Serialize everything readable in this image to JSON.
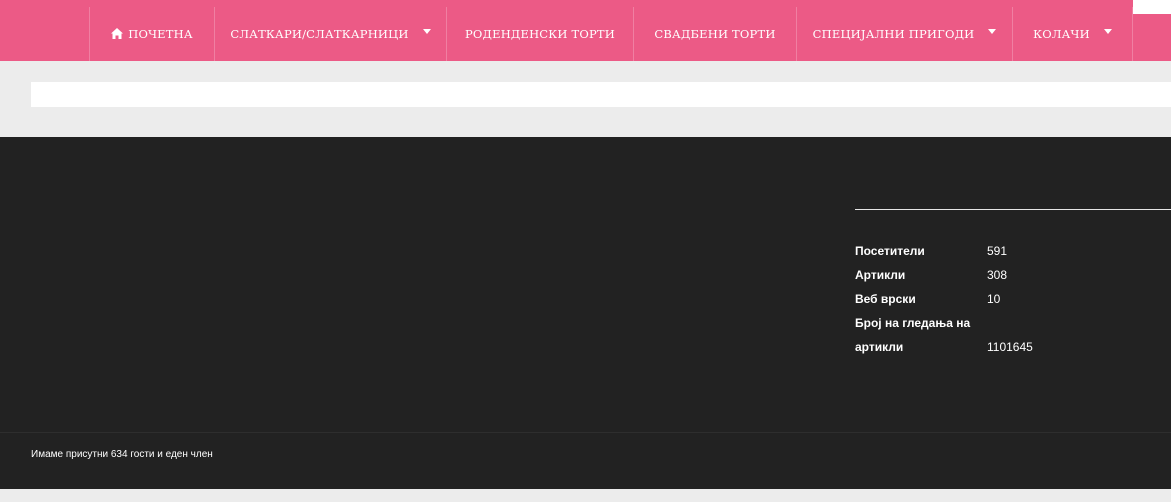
{
  "nav": {
    "items": [
      {
        "label": "ПОЧЕТНА",
        "icon": "home-icon",
        "dropdown": false
      },
      {
        "label": "СЛАТКАРИ/СЛАТКАРНИЦИ",
        "dropdown": true
      },
      {
        "label": "РОДЕНДЕНСКИ ТОРТИ",
        "dropdown": false
      },
      {
        "label": "СВАДБЕНИ ТОРТИ",
        "dropdown": false
      },
      {
        "label": "СПЕЦИЈАЛНИ ПРИГОДИ",
        "dropdown": true
      },
      {
        "label": "КОЛАЧИ",
        "dropdown": true
      }
    ]
  },
  "stats": {
    "rows": [
      {
        "label": "Посетители",
        "value": "591"
      },
      {
        "label": "Артикли",
        "value": "308"
      },
      {
        "label": "Веб врски",
        "value": "10"
      },
      {
        "label_line1": "Број на гледања на",
        "label_line2": "артикли",
        "value": "1101645"
      }
    ]
  },
  "footer": {
    "online_text": "Имаме присутни 634 гости и еден член"
  },
  "colors": {
    "nav_background": "#ec5a86",
    "footer_background": "#222222",
    "page_background": "#ececec"
  }
}
